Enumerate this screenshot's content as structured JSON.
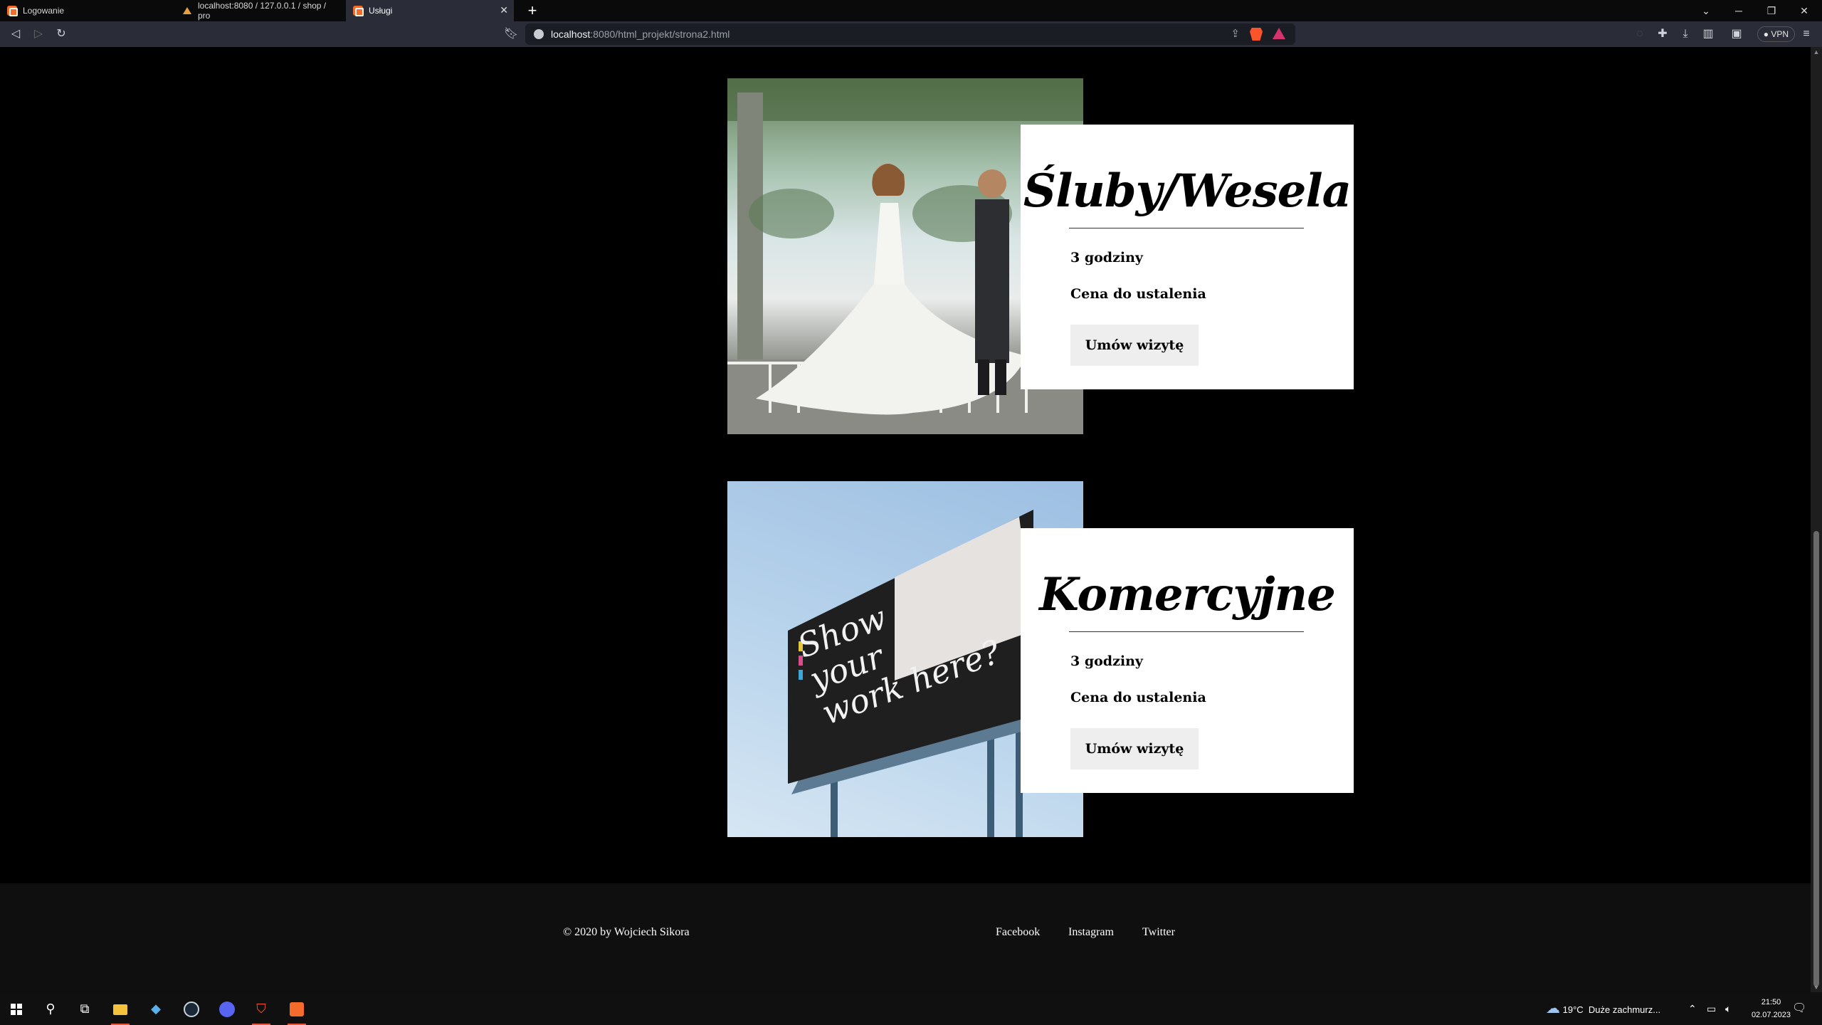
{
  "browser": {
    "tabs": [
      {
        "title": "Logowanie",
        "active": false
      },
      {
        "title": "localhost:8080 / 127.0.0.1 / shop / pro",
        "active": false
      },
      {
        "title": "Usługi",
        "active": true
      }
    ],
    "address": {
      "host": "localhost",
      "path": ":8080/html_projekt/strona2.html"
    },
    "vpn_label": "VPN"
  },
  "services": [
    {
      "title": "Śluby/Wesela",
      "duration": "3 godziny",
      "price": "Cena do ustalenia",
      "button": "Umów wizytę",
      "image": "wedding-couple-photo"
    },
    {
      "title": "Komercyjne",
      "duration": "3 godziny",
      "price": "Cena do ustalenia",
      "button": "Umów wizytę",
      "image": "billboard-photo",
      "image_text": "Show your work here?"
    }
  ],
  "footer": {
    "copyright": "© 2020 by Wojciech Sikora",
    "links": [
      "Facebook",
      "Instagram",
      "Twitter"
    ]
  },
  "taskbar": {
    "weather": {
      "temp": "19°C",
      "desc": "Duże zachmurz..."
    },
    "time": "21:50",
    "date": "02.07.2023"
  },
  "colors": {
    "page_bg": "#000000",
    "card_bg": "#ffffff",
    "button_bg": "#eeeeee",
    "footer_bg": "#0f0f0f",
    "brave_orange": "#fb542b"
  }
}
